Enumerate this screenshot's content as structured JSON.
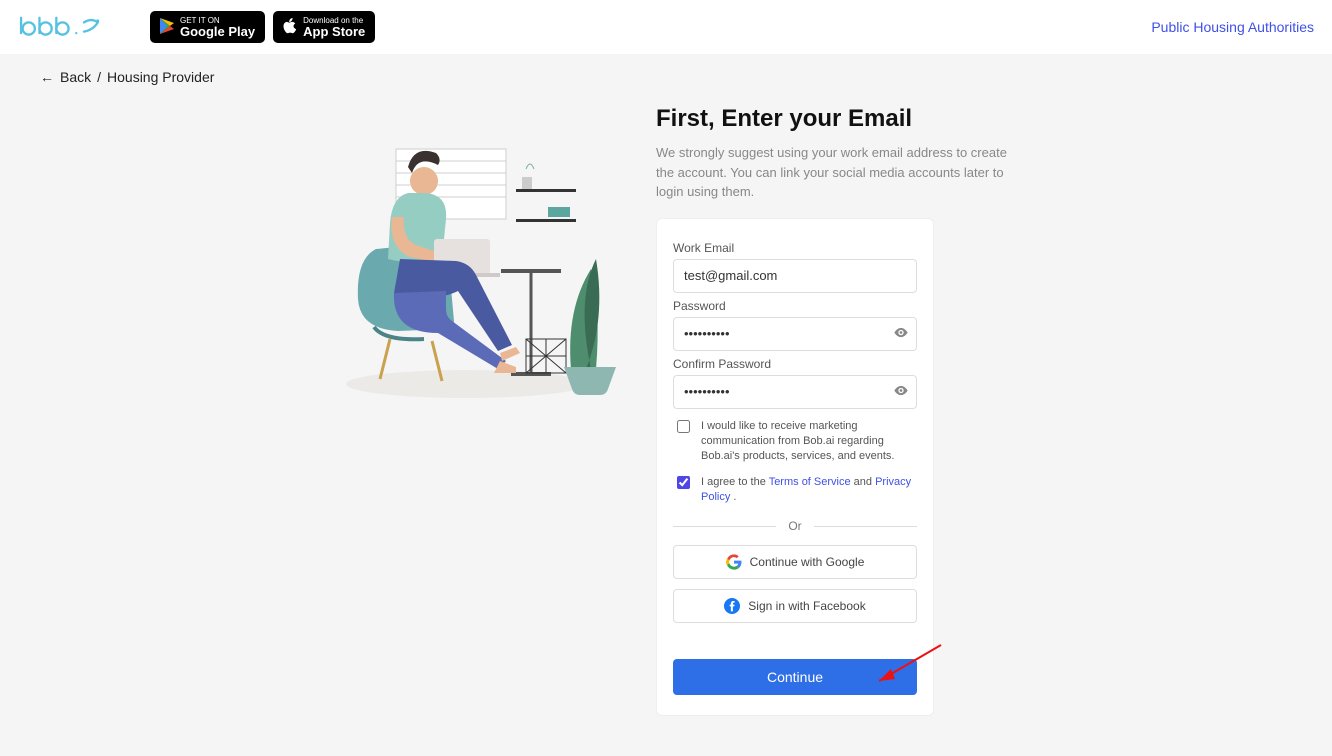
{
  "header": {
    "googleplay_tiny": "GET IT ON",
    "googleplay_big": "Google Play",
    "appstore_tiny": "Download on the",
    "appstore_big": "App Store",
    "pha_link": "Public Housing Authorities"
  },
  "breadcrumb": {
    "back": "Back",
    "sep": "/",
    "current": "Housing Provider"
  },
  "form": {
    "title": "First, Enter your Email",
    "subtitle": "We strongly suggest using your work email address to create the account. You can link your social media accounts later to login using them.",
    "work_email_label": "Work Email",
    "work_email_value": "test@gmail.com",
    "password_label": "Password",
    "password_value": "••••••••••",
    "confirm_label": "Confirm Password",
    "confirm_value": "••••••••••",
    "marketing_text": "I would like to receive marketing communication from Bob.ai regarding Bob.ai's products, services, and events.",
    "agree_prefix": "I agree to the ",
    "tos": "Terms of Service",
    "and": " and ",
    "privacy": "Privacy Policy",
    "dot": " .",
    "or": "Or",
    "google": "Continue with Google",
    "facebook": "Sign in with Facebook",
    "continue": "Continue"
  }
}
